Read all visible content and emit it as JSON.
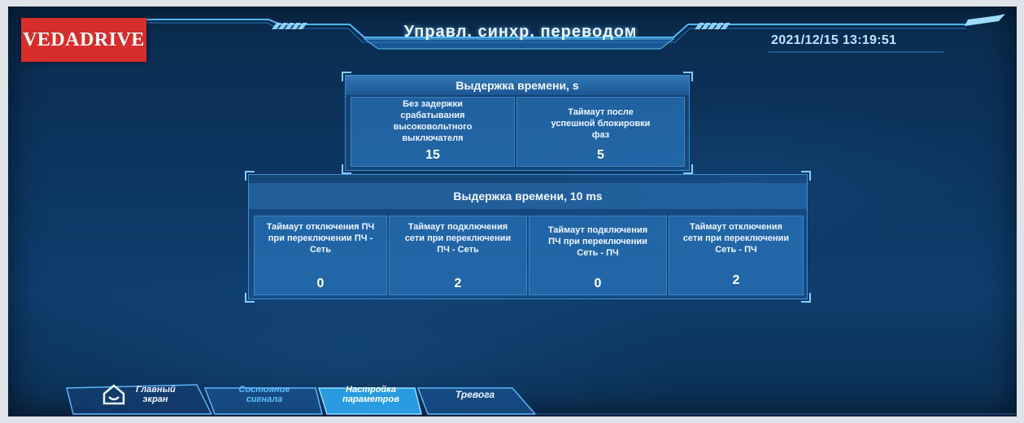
{
  "header": {
    "logo": "VEDADRIVE",
    "title": "Управл. синхр. переводом",
    "datetime": "2021/12/15 13:19:51"
  },
  "panel_s": {
    "title": "Выдержка времени, s",
    "cells": [
      {
        "label": "Без задержки срабатывания высоковольтного выключателя",
        "value": "15"
      },
      {
        "label": "Таймаут после успешной блокировки фаз",
        "value": "5"
      }
    ]
  },
  "panel_ms": {
    "title": "Выдержка времени, 10 ms",
    "cells": [
      {
        "label": "Таймаут отключения ПЧ при переключении ПЧ - Сеть",
        "value": "0"
      },
      {
        "label": "Таймаут подключения сети при переключении ПЧ - Сеть",
        "value": "2"
      },
      {
        "label": "Таймаут подключения ПЧ при переключении Сеть - ПЧ",
        "value": "0"
      },
      {
        "label": "Таймаут отключения сети при переключении Сеть - ПЧ",
        "value": "2"
      }
    ]
  },
  "nav": {
    "tabs": [
      {
        "label": "Главный экран",
        "icon": "home-icon",
        "active": false
      },
      {
        "label": "Состояние сигнала",
        "active": false
      },
      {
        "label": "Настройка параметров",
        "active": true
      },
      {
        "label": "Тревога",
        "active": false
      }
    ]
  },
  "colors": {
    "logo_bg": "#d62d2d",
    "accent": "#3d8fd6",
    "active_tab": "#2fb3ff"
  }
}
